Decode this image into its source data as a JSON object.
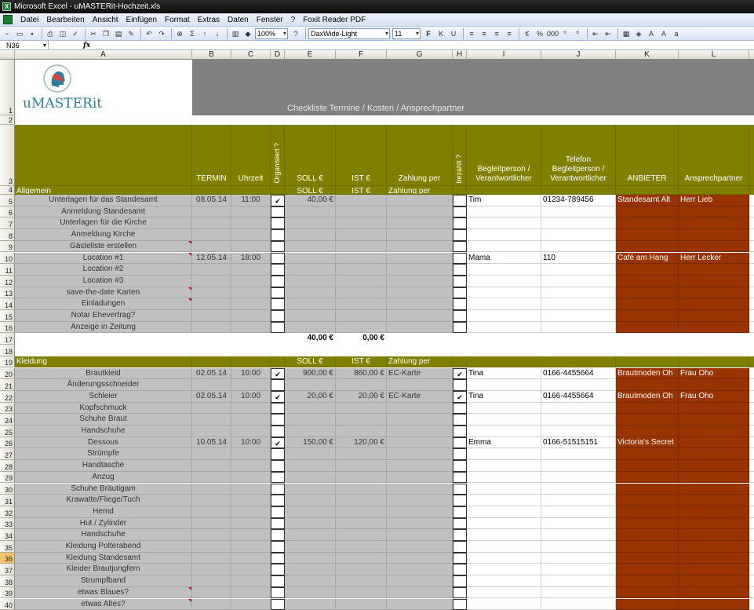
{
  "window": {
    "title": "Microsoft Excel - uMASTERit-Hochzeit.xls",
    "app_icon_letter": "X"
  },
  "menu": [
    "Datei",
    "Bearbeiten",
    "Ansicht",
    "Einfügen",
    "Format",
    "Extras",
    "Daten",
    "Fenster",
    "?",
    "Foxit Reader PDF"
  ],
  "toolbar": {
    "zoom": "100%",
    "font": "DaxWide-Light",
    "size": "11",
    "bold": "F",
    "italic": "K",
    "underline": "U",
    "percent": "%",
    "thousands": "000"
  },
  "formula": {
    "namebox": "N36",
    "fx": "fx"
  },
  "columns": [
    "A",
    "B",
    "C",
    "D",
    "E",
    "F",
    "G",
    "H",
    "I",
    "J",
    "K",
    "L"
  ],
  "logo": {
    "text": "uMASTERit"
  },
  "banner": {
    "title": "Checkliste Termine / Kosten / Ansprechpartner"
  },
  "headers": {
    "termin": "TERMIN",
    "uhrzeit": "Uhrzeit",
    "organisiert": "Organisiert ?",
    "soll": "SOLL €",
    "ist": "IST €",
    "zahlung": "Zahlung per",
    "bezahlt": "bezahlt ?",
    "begleit": "Begleitperson / Verantwortlicher",
    "telefon": "Telefon Begleitperson / Verantwortlicher",
    "anbieter": "ANBIETER",
    "ansprech": "Ansprechpartner"
  },
  "sections": {
    "allgemein": {
      "label": "Allgemein",
      "soll": "SOLL €",
      "ist": "IST €",
      "zahlung": "Zahlung per",
      "sum_soll": "40,00 €",
      "sum_ist": "0,00 €"
    },
    "kleidung": {
      "label": "Kleidung",
      "soll": "SOLL €",
      "ist": "IST €",
      "zahlung": "Zahlung per"
    }
  },
  "rows": [
    {
      "n": "1"
    },
    {
      "n": "2"
    },
    {
      "n": "3"
    },
    {
      "n": "4"
    },
    {
      "n": "5",
      "task": "Unterlagen für das Standesamt",
      "termin": "08.05.14",
      "uhrzeit": "11:00",
      "org": "✔",
      "soll": "40,00 €",
      "ist": "",
      "zahlung": "",
      "bez": "",
      "begleit": "Tim",
      "tel": "01234-789456",
      "anbieter": "Standesamt Alt",
      "ansprech": "Herr Lieb"
    },
    {
      "n": "6",
      "task": "Anmeldung Standesamt"
    },
    {
      "n": "7",
      "task": "Unterlagen für die Kirche"
    },
    {
      "n": "8",
      "task": "Anmeldung Kirche"
    },
    {
      "n": "9",
      "task": "Gästeliste erstellen",
      "comment": true
    },
    {
      "n": "10",
      "task": "Location #1",
      "termin": "12.05.14",
      "uhrzeit": "18:00",
      "begleit": "Mama",
      "tel": "110",
      "anbieter": "Café am Hang",
      "ansprech": "Herr Lecker",
      "comment": true
    },
    {
      "n": "11",
      "task": "Location #2"
    },
    {
      "n": "12",
      "task": "Location #3"
    },
    {
      "n": "13",
      "task": "save-the-date Karten",
      "comment": true
    },
    {
      "n": "14",
      "task": "Einladungen",
      "comment": true
    },
    {
      "n": "15",
      "task": "Notar Ehevertrag?"
    },
    {
      "n": "16",
      "task": "Anzeige in Zeitung"
    },
    {
      "n": "17"
    },
    {
      "n": "18"
    },
    {
      "n": "19"
    },
    {
      "n": "20",
      "task": "Brautkleid",
      "termin": "02.05.14",
      "uhrzeit": "10:00",
      "org": "✔",
      "soll": "900,00 €",
      "ist": "860,00 €",
      "zahlung": "EC-Karte",
      "bez": "✔",
      "begleit": "Tina",
      "tel": "0166-4455664",
      "anbieter": "Brautmoden Oh",
      "ansprech": "Frau Oho"
    },
    {
      "n": "21",
      "task": "Änderungsschneider"
    },
    {
      "n": "22",
      "task": "Schleier",
      "termin": "02.05.14",
      "uhrzeit": "10:00",
      "org": "✔",
      "soll": "20,00 €",
      "ist": "20,00 €",
      "zahlung": "EC-Karte",
      "bez": "✔",
      "begleit": "Tina",
      "tel": "0166-4455664",
      "anbieter": "Brautmoden Oh",
      "ansprech": "Frau Oho"
    },
    {
      "n": "23",
      "task": "Kopfschmuck"
    },
    {
      "n": "24",
      "task": "Schuhe Braut"
    },
    {
      "n": "25",
      "task": "Handschuhe"
    },
    {
      "n": "26",
      "task": "Dessous",
      "termin": "10.05.14",
      "uhrzeit": "10:00",
      "org": "✔",
      "soll": "150,00 €",
      "ist": "120,00 €",
      "begleit": "Emma",
      "tel": "0166-51515151",
      "anbieter": "Victoria's Secret"
    },
    {
      "n": "27",
      "task": "Strümpfe"
    },
    {
      "n": "28",
      "task": "Handtasche"
    },
    {
      "n": "29",
      "task": "Anzug"
    },
    {
      "n": "30",
      "task": "Schuhe Bräutigam"
    },
    {
      "n": "31",
      "task": "Krawatte/Fliege/Tuch"
    },
    {
      "n": "32",
      "task": "Hemd"
    },
    {
      "n": "33",
      "task": "Hut / Zylinder"
    },
    {
      "n": "34",
      "task": "Handschuhe"
    },
    {
      "n": "35",
      "task": "Kleidung Polterabend"
    },
    {
      "n": "36",
      "task": "Kleidung Standesamt",
      "selected": true
    },
    {
      "n": "37",
      "task": "Kleider Brautjungfern"
    },
    {
      "n": "38",
      "task": "Strumpfband"
    },
    {
      "n": "39",
      "task": "etwas Blaues?",
      "comment": true
    },
    {
      "n": "40",
      "task": "etwas Altes?",
      "comment": true
    }
  ]
}
